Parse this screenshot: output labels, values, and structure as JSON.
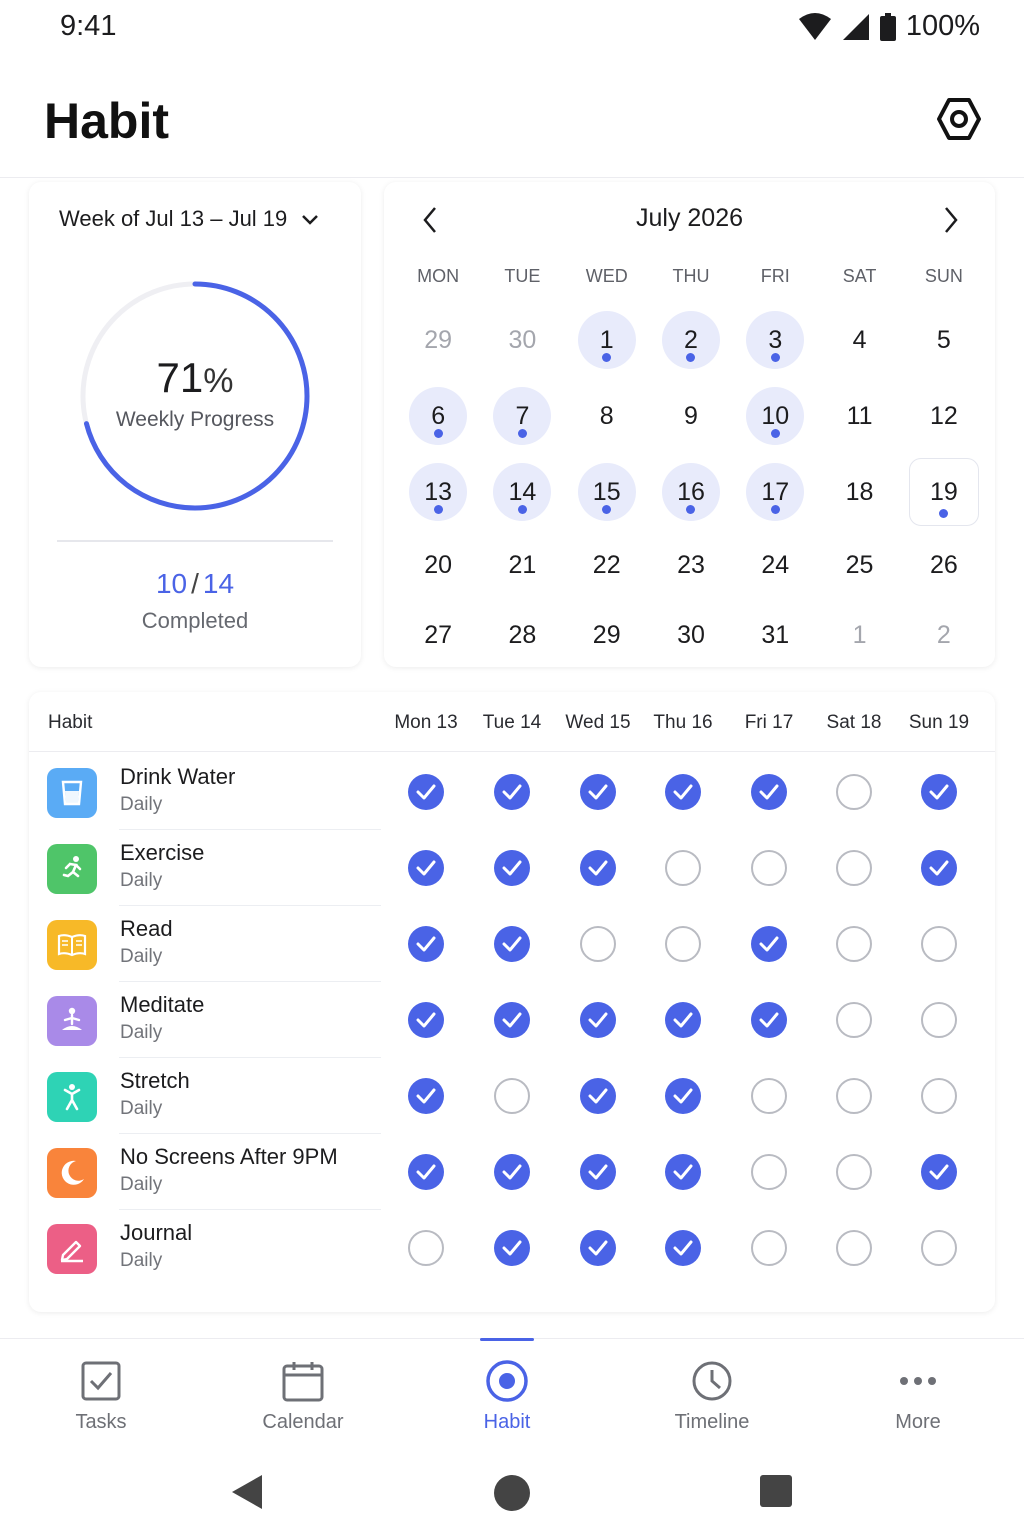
{
  "status_bar": {
    "time": "9:41",
    "battery": "100%"
  },
  "header": {
    "title": "Habit"
  },
  "progress": {
    "week_label": "Week of Jul 13 – Jul 19",
    "percent": "71",
    "percent_unit": "%",
    "percent_value": 0.71,
    "label": "Weekly Progress",
    "completed": "10",
    "total": "14",
    "slash": "/",
    "completed_label": "Completed"
  },
  "calendar": {
    "title": "July 2026",
    "weekdays": [
      "MON",
      "TUE",
      "WED",
      "THU",
      "FRI",
      "SAT",
      "SUN"
    ],
    "days": [
      {
        "d": "29",
        "muted": true
      },
      {
        "d": "30",
        "muted": true
      },
      {
        "d": "1",
        "done": true
      },
      {
        "d": "2",
        "done": true
      },
      {
        "d": "3",
        "done": true
      },
      {
        "d": "4"
      },
      {
        "d": "5"
      },
      {
        "d": "6",
        "done": true
      },
      {
        "d": "7",
        "done": true
      },
      {
        "d": "8"
      },
      {
        "d": "9"
      },
      {
        "d": "10",
        "done": true
      },
      {
        "d": "11"
      },
      {
        "d": "12"
      },
      {
        "d": "13",
        "done": true
      },
      {
        "d": "14",
        "done": true
      },
      {
        "d": "15",
        "done": true
      },
      {
        "d": "16",
        "done": true
      },
      {
        "d": "17",
        "done": true
      },
      {
        "d": "18"
      },
      {
        "d": "19",
        "today": true
      },
      {
        "d": "20"
      },
      {
        "d": "21"
      },
      {
        "d": "22"
      },
      {
        "d": "23"
      },
      {
        "d": "24"
      },
      {
        "d": "25"
      },
      {
        "d": "26"
      },
      {
        "d": "27"
      },
      {
        "d": "28"
      },
      {
        "d": "29"
      },
      {
        "d": "30"
      },
      {
        "d": "31"
      },
      {
        "d": "1",
        "muted": true
      },
      {
        "d": "2",
        "muted": true
      }
    ]
  },
  "table": {
    "habit_header": "Habit",
    "days": [
      "Mon 13",
      "Tue 14",
      "Wed 15",
      "Thu 16",
      "Fri 17",
      "Sat 18",
      "Sun 19"
    ],
    "habits": [
      {
        "name": "Drink Water",
        "freq": "Daily",
        "icon": "cup-icon",
        "color": "#5aabf5",
        "checks": [
          1,
          1,
          1,
          1,
          1,
          0,
          1
        ]
      },
      {
        "name": "Exercise",
        "freq": "Daily",
        "icon": "running-icon",
        "color": "#4fc569",
        "checks": [
          1,
          1,
          1,
          0,
          0,
          0,
          1
        ]
      },
      {
        "name": "Read",
        "freq": "Daily",
        "icon": "book-icon",
        "color": "#f7b928",
        "checks": [
          1,
          1,
          0,
          0,
          1,
          0,
          0
        ]
      },
      {
        "name": "Meditate",
        "freq": "Daily",
        "icon": "meditation-icon",
        "color": "#a98ae8",
        "checks": [
          1,
          1,
          1,
          1,
          1,
          0,
          0
        ]
      },
      {
        "name": "Stretch",
        "freq": "Daily",
        "icon": "stretch-icon",
        "color": "#2ed3b5",
        "checks": [
          1,
          0,
          1,
          1,
          0,
          0,
          0
        ]
      },
      {
        "name": "No Screens After 9PM",
        "freq": "Daily",
        "icon": "moon-icon",
        "color": "#f9843b",
        "checks": [
          1,
          1,
          1,
          1,
          0,
          0,
          1
        ]
      },
      {
        "name": "Journal",
        "freq": "Daily",
        "icon": "pencil-icon",
        "color": "#ec5f86",
        "checks": [
          0,
          1,
          1,
          1,
          0,
          0,
          0
        ]
      }
    ]
  },
  "nav": {
    "items": [
      {
        "label": "Tasks",
        "icon": "checkbox-icon"
      },
      {
        "label": "Calendar",
        "icon": "calendar-icon"
      },
      {
        "label": "Habit",
        "icon": "target-icon",
        "active": true
      },
      {
        "label": "Timeline",
        "icon": "clock-icon"
      },
      {
        "label": "More",
        "icon": "more-icon"
      }
    ]
  },
  "colors": {
    "accent": "#4a63e6",
    "done_bg": "#e8ebfb",
    "check_off": "#b9bbc2"
  }
}
